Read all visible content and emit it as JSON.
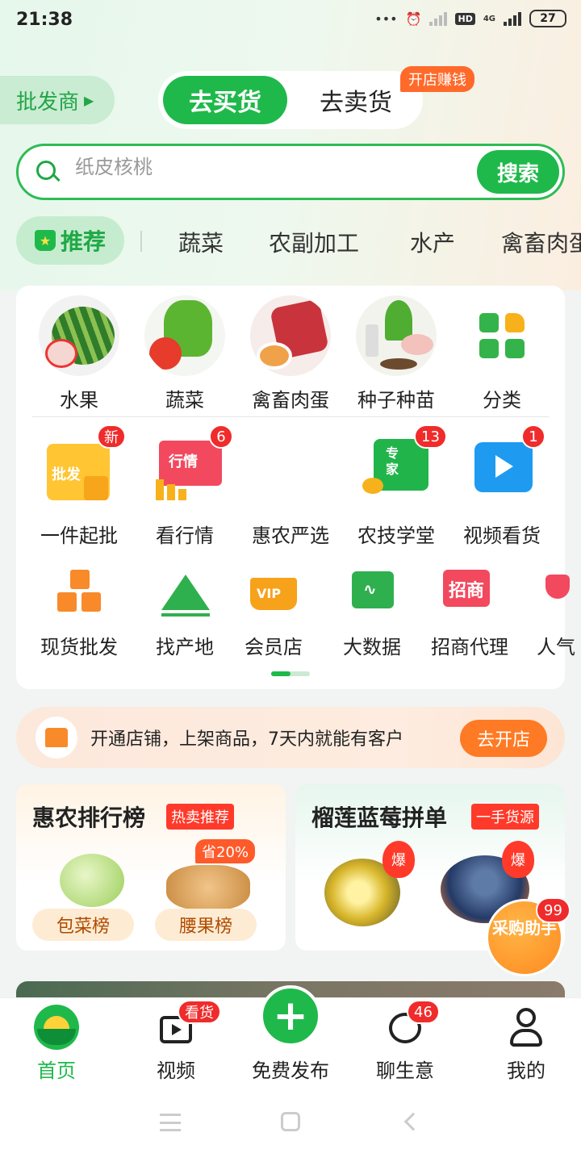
{
  "status_bar": {
    "time": "21:38",
    "hd": "HD",
    "network": "4G",
    "battery": "27"
  },
  "header": {
    "wholesaler": "批发商",
    "tab_buy": "去买货",
    "tab_sell": "去卖货",
    "open_badge": "开店赚钱"
  },
  "search": {
    "placeholder": "纸皮核桃",
    "button": "搜索"
  },
  "categories": {
    "active": "推荐",
    "items": [
      "蔬菜",
      "农副加工",
      "水产",
      "禽畜肉蛋"
    ]
  },
  "grid": {
    "row1": [
      "水果",
      "蔬菜",
      "禽畜肉蛋",
      "种子种苗",
      "分类"
    ],
    "row2": [
      {
        "label": "一件起批",
        "badge": "新",
        "icon_text": "批发"
      },
      {
        "label": "看行情",
        "badge": "6",
        "icon_text": "行情"
      },
      {
        "label": "惠农严选",
        "badge": ""
      },
      {
        "label": "农技学堂",
        "badge": "13",
        "icon_text": "专家"
      },
      {
        "label": "视频看货",
        "badge": "1"
      }
    ],
    "row3": [
      {
        "label": "现货批发"
      },
      {
        "label": "找产地"
      },
      {
        "label": "会员店",
        "icon_text": "VIP"
      },
      {
        "label": "大数据"
      },
      {
        "label": "招商代理",
        "icon_text": "招商"
      },
      {
        "label": "人气"
      }
    ]
  },
  "shop_banner": {
    "text": "开通店铺，上架商品，7天内就能有客户",
    "button": "去开店"
  },
  "promo_left": {
    "title": "惠农排行榜",
    "tag": "热卖推荐",
    "save": "省20%",
    "pill1": "包菜榜",
    "pill2": "腰果榜"
  },
  "promo_right": {
    "title": "榴莲蓝莓拼单",
    "tag": "一手货源",
    "hot": "爆"
  },
  "assistant": {
    "label": "采购助手",
    "badge": "99"
  },
  "bottom_nav": {
    "home": "首页",
    "video": "视频",
    "video_badge": "看货",
    "publish": "免费发布",
    "chat": "聊生意",
    "chat_badge": "46",
    "me": "我的"
  }
}
